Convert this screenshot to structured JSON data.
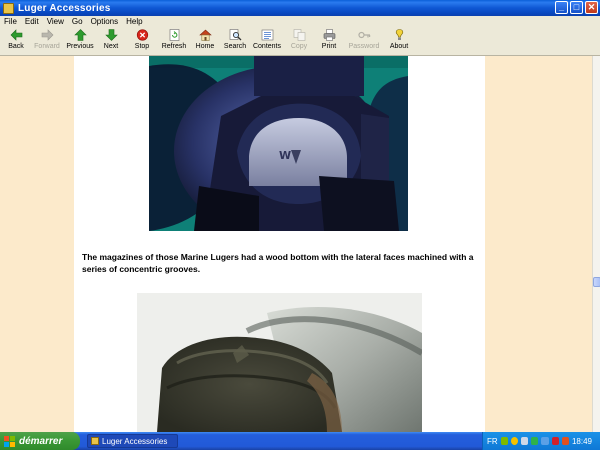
{
  "window": {
    "title": "Luger Accessories",
    "buttons": {
      "minimize": "_",
      "maximize": "□",
      "close": "✕"
    }
  },
  "menu": [
    "File",
    "Edit",
    "View",
    "Go",
    "Options",
    "Help"
  ],
  "toolbar": [
    {
      "label": "Back",
      "icon": "back-arrow-icon",
      "enabled": true
    },
    {
      "label": "Forward",
      "icon": "forward-arrow-icon",
      "enabled": false
    },
    {
      "label": "Previous",
      "icon": "up-arrow-icon",
      "enabled": true
    },
    {
      "label": "Next",
      "icon": "down-arrow-icon",
      "enabled": true
    },
    {
      "label": "Stop",
      "icon": "stop-icon",
      "enabled": true
    },
    {
      "label": "Refresh",
      "icon": "refresh-icon",
      "enabled": true
    },
    {
      "label": "Home",
      "icon": "home-icon",
      "enabled": true
    },
    {
      "label": "Search",
      "icon": "search-icon",
      "enabled": true
    },
    {
      "label": "Contents",
      "icon": "contents-icon",
      "enabled": true
    },
    {
      "label": "Copy",
      "icon": "copy-icon",
      "enabled": false
    },
    {
      "label": "Print",
      "icon": "print-icon",
      "enabled": true
    },
    {
      "label": "Password",
      "icon": "key-icon",
      "enabled": false
    },
    {
      "label": "About",
      "icon": "about-icon",
      "enabled": true
    }
  ],
  "content": {
    "paragraph": "The magazines of those Marine Lugers had a wood bottom with the lateral faces machined with a series of concentric grooves."
  },
  "taskbar": {
    "start_label": "démarrer",
    "task_label": "Luger Accessories",
    "language": "FR",
    "clock": "18:49"
  },
  "colors": {
    "page_background": "#fceacb",
    "titlebar": "#0a4fd0",
    "start_button": "#3c9a37"
  }
}
